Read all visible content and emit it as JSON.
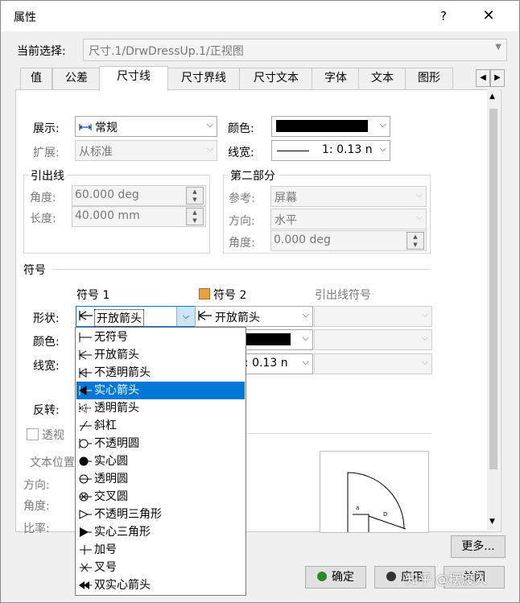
{
  "window": {
    "title": "属性",
    "help": "?",
    "close": "✕"
  },
  "selection": {
    "label": "当前选择:",
    "value": "尺寸.1/DrwDressUp.1/正视图"
  },
  "tabs": [
    "值",
    "公差",
    "尺寸线",
    "尺寸界线",
    "尺寸文本",
    "字体",
    "文本",
    "图形"
  ],
  "active_tab": "尺寸线",
  "display": {
    "label": "展示:",
    "value": "常规"
  },
  "extension": {
    "label": "扩展:",
    "value": "从标准"
  },
  "color": {
    "label": "颜色:",
    "value": "#000000"
  },
  "linewidth": {
    "label": "线宽:",
    "value": "1: 0.13 n"
  },
  "leader": {
    "title": "引出线",
    "angle_label": "角度:",
    "angle_value": "60.000 deg",
    "length_label": "长度:",
    "length_value": "40.000 mm"
  },
  "second_part": {
    "title": "第二部分",
    "ref_label": "参考:",
    "ref_value": "屏幕",
    "dir_label": "方向:",
    "dir_value": "水平",
    "angle_label": "角度:",
    "angle_value": "0.000 deg"
  },
  "symbols": {
    "title": "符号",
    "col1": "符号 1",
    "col2": "符号 2",
    "col3": "引出线符号",
    "shape_label": "形状:",
    "shape1": "开放箭头",
    "shape2": "开放箭头",
    "color_label": "颜色:",
    "width_label": "线宽:",
    "width2": "1: 0.13 n",
    "reverse_label": "反转:"
  },
  "perspective_label": "透视",
  "lower": {
    "pos_label": "文本位置",
    "dir_label": "方向:",
    "angle_label": "角度:",
    "ratio_label": "比率:"
  },
  "dropdown_items": [
    "无符号",
    "开放箭头",
    "不透明箭头",
    "实心箭头",
    "透明箭头",
    "斜杠",
    "不透明圆",
    "实心圆",
    "透明圆",
    "交叉圆",
    "不透明三角形",
    "实心三角形",
    "加号",
    "叉号",
    "双实心箭头"
  ],
  "dropdown_selected": "实心箭头",
  "buttons": {
    "more": "更多...",
    "ok": "确定",
    "apply": "应用",
    "close": "关闭"
  },
  "watermark": "知乎 @摆渡人"
}
